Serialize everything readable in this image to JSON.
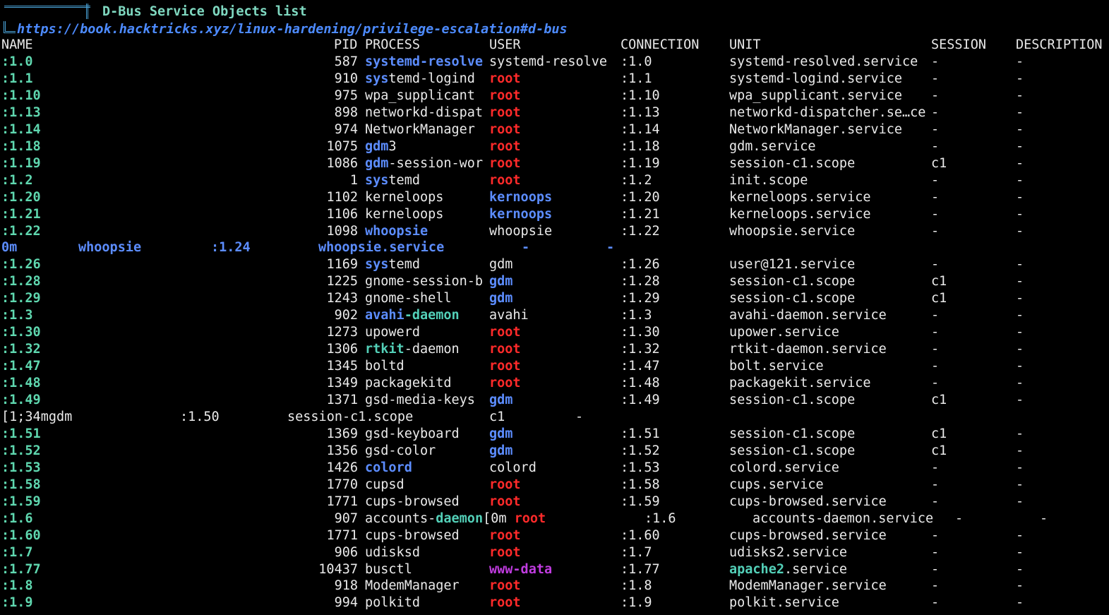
{
  "header": {
    "title": "D-Bus Service Objects list",
    "url": "https://book.hacktricks.xyz/linux-hardening/privilege-escalation#d-bus"
  },
  "columns": [
    "NAME",
    "PID",
    "PROCESS",
    "USER",
    "CONNECTION",
    "UNIT",
    "SESSION",
    "DESCRIPTION"
  ],
  "rows": [
    {
      "name": ":1.0",
      "pid": "587",
      "proc": [
        [
          "systemd-resolve",
          "bl"
        ]
      ],
      "user": [
        [
          "systemd-resolve",
          "w"
        ]
      ],
      "conn": ":1.0",
      "unit": [
        [
          "systemd-resolved.service",
          "w"
        ]
      ],
      "session": "-",
      "desc": "-"
    },
    {
      "name": ":1.1",
      "pid": "910",
      "proc": [
        [
          "sys",
          "bl"
        ],
        [
          "temd-logind",
          "w"
        ]
      ],
      "user": [
        [
          "root",
          "r"
        ]
      ],
      "conn": ":1.1",
      "unit": [
        [
          "systemd-logind.service",
          "w"
        ]
      ],
      "session": "-",
      "desc": "-"
    },
    {
      "name": ":1.10",
      "pid": "975",
      "proc": [
        [
          "wpa_supplicant",
          "w"
        ]
      ],
      "user": [
        [
          "root",
          "r"
        ]
      ],
      "conn": ":1.10",
      "unit": [
        [
          "wpa_supplicant.service",
          "w"
        ]
      ],
      "session": "-",
      "desc": "-"
    },
    {
      "name": ":1.13",
      "pid": "898",
      "proc": [
        [
          "networkd-dispat",
          "w"
        ]
      ],
      "user": [
        [
          "root",
          "r"
        ]
      ],
      "conn": ":1.13",
      "unit": [
        [
          "networkd-dispatcher.se…ce",
          "w"
        ]
      ],
      "session": "-",
      "desc": "-"
    },
    {
      "name": ":1.14",
      "pid": "974",
      "proc": [
        [
          "NetworkManager",
          "w"
        ]
      ],
      "user": [
        [
          "root",
          "r"
        ]
      ],
      "conn": ":1.14",
      "unit": [
        [
          "NetworkManager.service",
          "w"
        ]
      ],
      "session": "-",
      "desc": "-"
    },
    {
      "name": ":1.18",
      "pid": "1075",
      "proc": [
        [
          "gdm",
          "bl"
        ],
        [
          "3",
          "w"
        ]
      ],
      "user": [
        [
          "root",
          "r"
        ]
      ],
      "conn": ":1.18",
      "unit": [
        [
          "gdm.service",
          "w"
        ]
      ],
      "session": "-",
      "desc": "-"
    },
    {
      "name": ":1.19",
      "pid": "1086",
      "proc": [
        [
          "gdm",
          "bl"
        ],
        [
          "-session-wor",
          "w"
        ]
      ],
      "user": [
        [
          "root",
          "r"
        ]
      ],
      "conn": ":1.19",
      "unit": [
        [
          "session-c1.scope",
          "w"
        ]
      ],
      "session": "c1",
      "desc": "-"
    },
    {
      "name": ":1.2",
      "pid": "1",
      "proc": [
        [
          "sys",
          "bl"
        ],
        [
          "temd",
          "w"
        ]
      ],
      "user": [
        [
          "root",
          "r"
        ]
      ],
      "conn": ":1.2",
      "unit": [
        [
          "init.scope",
          "w"
        ]
      ],
      "session": "-",
      "desc": "-"
    },
    {
      "name": ":1.20",
      "pid": "1102",
      "proc": [
        [
          "kerneloops",
          "w"
        ]
      ],
      "user": [
        [
          "kernoops",
          "bl"
        ]
      ],
      "conn": ":1.20",
      "unit": [
        [
          "kerneloops.service",
          "w"
        ]
      ],
      "session": "-",
      "desc": "-"
    },
    {
      "name": ":1.21",
      "pid": "1106",
      "proc": [
        [
          "kerneloops",
          "w"
        ]
      ],
      "user": [
        [
          "kernoops",
          "bl"
        ]
      ],
      "conn": ":1.21",
      "unit": [
        [
          "kerneloops.service",
          "w"
        ]
      ],
      "session": "-",
      "desc": "-"
    },
    {
      "name": ":1.22",
      "pid": "1098",
      "proc": [
        [
          "whoopsie",
          "bl"
        ]
      ],
      "user": [
        [
          "whoopsie",
          "w"
        ]
      ],
      "conn": ":1.22",
      "unit": [
        [
          "whoopsie.service",
          "w"
        ]
      ],
      "session": "-",
      "desc": "-"
    },
    {
      "raw": true,
      "parts": [
        [
          "0m",
          "bl",
          0
        ],
        [
          "whoopsie",
          "bl",
          109
        ],
        [
          ":1.24",
          "bl",
          297
        ],
        [
          "whoopsie.service",
          "bl",
          449
        ],
        [
          "-",
          "bl",
          737
        ],
        [
          "-",
          "bl",
          857
        ]
      ]
    },
    {
      "name": ":1.26",
      "pid": "1169",
      "proc": [
        [
          "sys",
          "bl"
        ],
        [
          "temd",
          "w"
        ]
      ],
      "user": [
        [
          "gdm",
          "w"
        ]
      ],
      "conn": ":1.26",
      "unit": [
        [
          "user@121.service",
          "w"
        ]
      ],
      "session": "-",
      "desc": "-"
    },
    {
      "name": ":1.28",
      "pid": "1225",
      "proc": [
        [
          "gnome-session-b",
          "w"
        ]
      ],
      "user": [
        [
          "gdm",
          "bl"
        ]
      ],
      "conn": ":1.28",
      "unit": [
        [
          "session-c1.scope",
          "w"
        ]
      ],
      "session": "c1",
      "desc": "-"
    },
    {
      "name": ":1.29",
      "pid": "1243",
      "proc": [
        [
          "gnome-shell",
          "w"
        ]
      ],
      "user": [
        [
          "gdm",
          "bl"
        ]
      ],
      "conn": ":1.29",
      "unit": [
        [
          "session-c1.scope",
          "w"
        ]
      ],
      "session": "c1",
      "desc": "-"
    },
    {
      "name": ":1.3",
      "pid": "902",
      "proc": [
        [
          "avahi",
          "bl"
        ],
        [
          "-daemon",
          "cy"
        ]
      ],
      "user": [
        [
          "avahi",
          "w"
        ]
      ],
      "conn": ":1.3",
      "unit": [
        [
          "avahi-daemon.service",
          "w"
        ]
      ],
      "session": "-",
      "desc": "-"
    },
    {
      "name": ":1.30",
      "pid": "1273",
      "proc": [
        [
          "upowerd",
          "w"
        ]
      ],
      "user": [
        [
          "root",
          "r"
        ]
      ],
      "conn": ":1.30",
      "unit": [
        [
          "upower.service",
          "w"
        ]
      ],
      "session": "-",
      "desc": "-"
    },
    {
      "name": ":1.32",
      "pid": "1306",
      "proc": [
        [
          "rtkit",
          "cy"
        ],
        [
          "-daemon",
          "w"
        ]
      ],
      "user": [
        [
          "root",
          "r"
        ]
      ],
      "conn": ":1.32",
      "unit": [
        [
          "rtkit-daemon.service",
          "w"
        ]
      ],
      "session": "-",
      "desc": "-"
    },
    {
      "name": ":1.47",
      "pid": "1345",
      "proc": [
        [
          "boltd",
          "w"
        ]
      ],
      "user": [
        [
          "root",
          "r"
        ]
      ],
      "conn": ":1.47",
      "unit": [
        [
          "bolt.service",
          "w"
        ]
      ],
      "session": "-",
      "desc": "-"
    },
    {
      "name": ":1.48",
      "pid": "1349",
      "proc": [
        [
          "packagekitd",
          "w"
        ]
      ],
      "user": [
        [
          "root",
          "r"
        ]
      ],
      "conn": ":1.48",
      "unit": [
        [
          "packagekit.service",
          "w"
        ]
      ],
      "session": "-",
      "desc": "-"
    },
    {
      "name": ":1.49",
      "pid": "1371",
      "proc": [
        [
          "gsd-media-keys",
          "w"
        ]
      ],
      "user": [
        [
          "gdm",
          "bl"
        ]
      ],
      "conn": ":1.49",
      "unit": [
        [
          "session-c1.scope",
          "w"
        ]
      ],
      "session": "c1",
      "desc": "-"
    },
    {
      "raw": true,
      "parts": [
        [
          "[1;34mgdm",
          "w",
          0
        ],
        [
          ":1.50",
          "w",
          253
        ],
        [
          "session-c1.scope",
          "w",
          405
        ],
        [
          "c1",
          "w",
          691
        ],
        [
          "-",
          "w",
          813
        ]
      ]
    },
    {
      "name": ":1.51",
      "pid": "1369",
      "proc": [
        [
          "gsd-keyboard",
          "w"
        ]
      ],
      "user": [
        [
          "gdm",
          "bl"
        ]
      ],
      "conn": ":1.51",
      "unit": [
        [
          "session-c1.scope",
          "w"
        ]
      ],
      "session": "c1",
      "desc": "-"
    },
    {
      "name": ":1.52",
      "pid": "1356",
      "proc": [
        [
          "gsd-color",
          "w"
        ]
      ],
      "user": [
        [
          "gdm",
          "bl"
        ]
      ],
      "conn": ":1.52",
      "unit": [
        [
          "session-c1.scope",
          "w"
        ]
      ],
      "session": "c1",
      "desc": "-"
    },
    {
      "name": ":1.53",
      "pid": "1426",
      "proc": [
        [
          "colord",
          "bl"
        ]
      ],
      "user": [
        [
          "colord",
          "w"
        ]
      ],
      "conn": ":1.53",
      "unit": [
        [
          "colord.service",
          "w"
        ]
      ],
      "session": "-",
      "desc": "-"
    },
    {
      "name": ":1.58",
      "pid": "1770",
      "proc": [
        [
          "cupsd",
          "w"
        ]
      ],
      "user": [
        [
          "root",
          "r"
        ]
      ],
      "conn": ":1.58",
      "unit": [
        [
          "cups.service",
          "w"
        ]
      ],
      "session": "-",
      "desc": "-"
    },
    {
      "name": ":1.59",
      "pid": "1771",
      "proc": [
        [
          "cups-browsed",
          "w"
        ]
      ],
      "user": [
        [
          "root",
          "r"
        ]
      ],
      "conn": ":1.59",
      "unit": [
        [
          "cups-browsed.service",
          "w"
        ]
      ],
      "session": "-",
      "desc": "-"
    },
    {
      "name": ":1.6",
      "pid": "907",
      "shifted": true,
      "proc": [
        [
          "accounts-",
          "w"
        ],
        [
          "daemon",
          "cy"
        ],
        [
          "[0m ",
          "w"
        ],
        [
          "root",
          "r"
        ]
      ],
      "conn": ":1.6",
      "unit": [
        [
          "accounts-daemon.service",
          "w"
        ]
      ],
      "session": "-",
      "desc": "-"
    },
    {
      "name": ":1.60",
      "pid": "1771",
      "proc": [
        [
          "cups-browsed",
          "w"
        ]
      ],
      "user": [
        [
          "root",
          "r"
        ]
      ],
      "conn": ":1.60",
      "unit": [
        [
          "cups-browsed.service",
          "w"
        ]
      ],
      "session": "-",
      "desc": "-"
    },
    {
      "name": ":1.7",
      "pid": "906",
      "proc": [
        [
          "udisksd",
          "w"
        ]
      ],
      "user": [
        [
          "root",
          "r"
        ]
      ],
      "conn": ":1.7",
      "unit": [
        [
          "udisks2.service",
          "w"
        ]
      ],
      "session": "-",
      "desc": "-"
    },
    {
      "name": ":1.77",
      "pid": "10437",
      "proc": [
        [
          "busctl",
          "w"
        ]
      ],
      "user": [
        [
          "www-data",
          "pu"
        ]
      ],
      "conn": ":1.77",
      "unit": [
        [
          "apache2",
          "cy"
        ],
        [
          ".service",
          "w"
        ]
      ],
      "session": "-",
      "desc": "-"
    },
    {
      "name": ":1.8",
      "pid": "918",
      "proc": [
        [
          "ModemManager",
          "w"
        ]
      ],
      "user": [
        [
          "root",
          "r"
        ]
      ],
      "conn": ":1.8",
      "unit": [
        [
          "ModemManager.service",
          "w"
        ]
      ],
      "session": "-",
      "desc": "-"
    },
    {
      "name": ":1.9",
      "pid": "994",
      "proc": [
        [
          "polkitd",
          "w"
        ]
      ],
      "user": [
        [
          "root",
          "r"
        ]
      ],
      "conn": ":1.9",
      "unit": [
        [
          "polkit.service",
          "w"
        ]
      ],
      "session": "-",
      "desc": "-"
    }
  ],
  "colors": {
    "background": "#000000",
    "name": "#5fd7af",
    "root": "#ff2a2a",
    "blue": "#5c8dff",
    "cyan": "#53d0b8",
    "purple": "#c03ce0",
    "text": "#e8e8e8"
  }
}
